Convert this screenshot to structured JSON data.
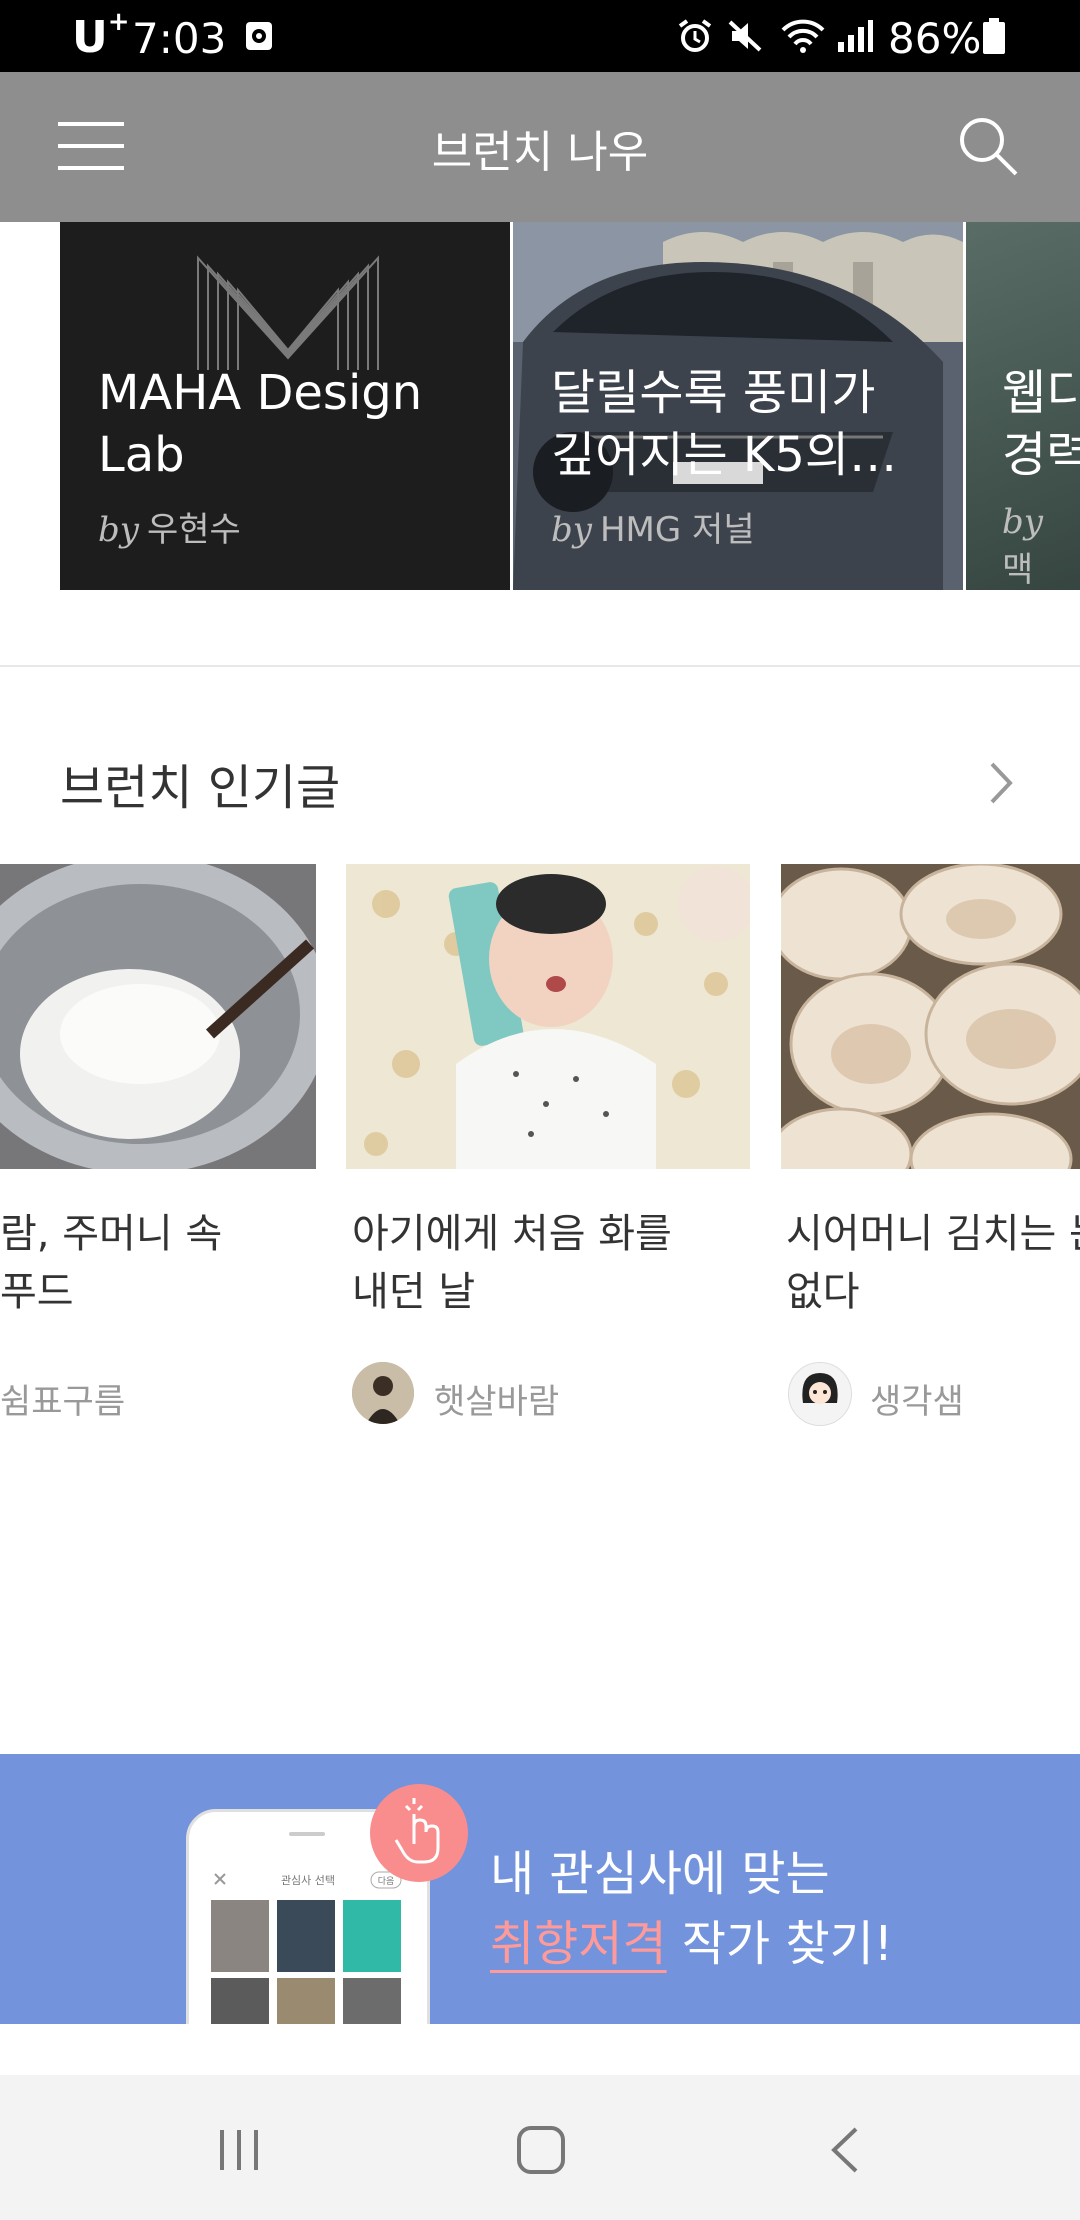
{
  "status_bar": {
    "carrier": "U",
    "carrier_sup": "+",
    "time": "7:03",
    "battery_percent": "86%",
    "icons": [
      "screenshot-icon",
      "alarm-icon",
      "mute-icon",
      "wifi-icon",
      "signal-icon",
      "battery-icon"
    ]
  },
  "header": {
    "title": "브런치 나우",
    "left_icon": "menu-icon",
    "right_icon": "search-icon"
  },
  "featured": [
    {
      "title": "MAHA Design Lab",
      "by": "by",
      "author": "우현수"
    },
    {
      "title": "달릴수록 풍미가 깊어지는 K5의…",
      "title_line1": "달릴수록 풍미가",
      "title_line2": "깊어지는 K5의…",
      "by": "by",
      "author": "HMG 저널"
    },
    {
      "title_line1": "웹디",
      "title_line2": "경력",
      "by": "by",
      "author": "맥"
    }
  ],
  "section": {
    "title": "브런치 인기글",
    "more_icon": "chevron-right-icon"
  },
  "posts": [
    {
      "title_line1": "람, 주머니 속",
      "title_line2": "푸드",
      "author": "쉼표구름"
    },
    {
      "title_line1": "아기에게 처음 화를",
      "title_line2": "내던 날",
      "author": "햇살바람"
    },
    {
      "title_line1": "시어머니 김치는 눈",
      "title_line2": "없다",
      "author": "생각샘"
    }
  ],
  "banner": {
    "line1": "내 관심사에 맞는",
    "highlight": "취향저격",
    "line2_rest": " 작가 찾기!",
    "phone_screen_title": "관심사 선택",
    "phone_next": "다음"
  },
  "colors": {
    "header_bg": "#8e8e8e",
    "banner_bg": "#7393dc",
    "highlight": "#ff9a9a"
  },
  "nav": [
    "recent-apps-icon",
    "home-icon",
    "back-icon"
  ]
}
